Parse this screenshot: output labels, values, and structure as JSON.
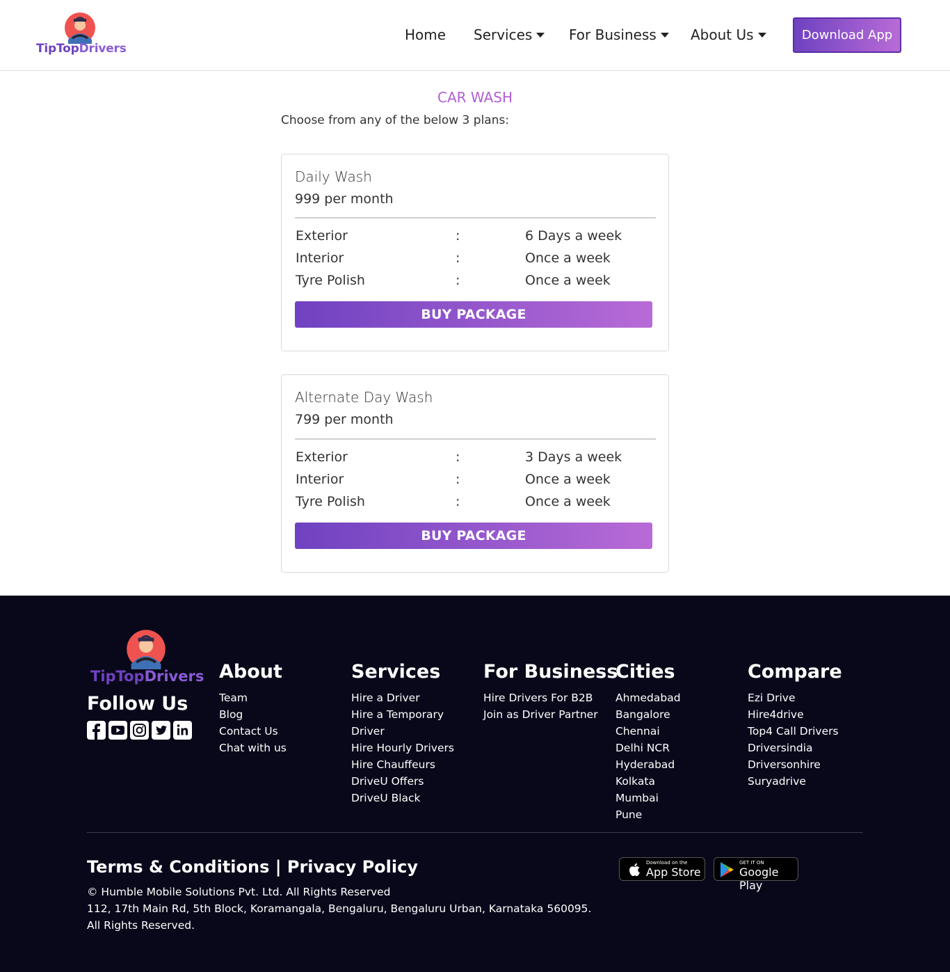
{
  "header": {
    "logo_part1": "TipTop",
    "logo_part2": "Drivers",
    "nav": {
      "home": "Home",
      "services": "Services",
      "for_business": "For Business",
      "about_us": "About Us"
    },
    "download_label": "Download App"
  },
  "main": {
    "title": "CAR WASH",
    "subtitle": "Choose from any of the below 3 plans:",
    "plans": [
      {
        "name": "Daily Wash",
        "price": "999 per month",
        "features": [
          {
            "label": "Exterior",
            "sep": ":",
            "value": "6 Days a week"
          },
          {
            "label": "Interior",
            "sep": ":",
            "value": "Once a week"
          },
          {
            "label": "Tyre Polish",
            "sep": ":",
            "value": "Once a week"
          }
        ],
        "button": "BUY PACKAGE"
      },
      {
        "name": "Alternate Day Wash",
        "price": "799 per month",
        "features": [
          {
            "label": "Exterior",
            "sep": ":",
            "value": "3 Days a week"
          },
          {
            "label": "Interior",
            "sep": ":",
            "value": "Once a week"
          },
          {
            "label": "Tyre Polish",
            "sep": ":",
            "value": "Once a week"
          }
        ],
        "button": "BUY PACKAGE"
      }
    ]
  },
  "footer": {
    "logo_part1": "TipTop",
    "logo_part2": "Drivers",
    "follow_us": "Follow Us",
    "social_icons": [
      "facebook-icon",
      "youtube-icon",
      "instagram-icon",
      "twitter-icon",
      "linkedin-icon"
    ],
    "columns": {
      "about": {
        "title": "About",
        "links": [
          "Team",
          "Blog",
          "Contact Us",
          "Chat with us"
        ]
      },
      "services": {
        "title": "Services",
        "links": [
          "Hire a Driver",
          "Hire a Temporary",
          "Driver",
          "Hire Hourly Drivers",
          "Hire Chauffeurs",
          "DriveU Offers",
          "DriveU Black"
        ]
      },
      "business": {
        "title": "For Business",
        "links": [
          "Hire Drivers For B2B",
          "Join as Driver Partner"
        ]
      },
      "cities": {
        "title": "Cities",
        "links": [
          "Ahmedabad",
          "Bangalore",
          "Chennai",
          "Delhi NCR",
          "Hyderabad",
          "Kolkata",
          "Mumbai",
          "Pune"
        ]
      },
      "compare": {
        "title": "Compare",
        "links": [
          "Ezi Drive",
          "Hire4drive",
          "Top4 Call Drivers",
          "Driversindia",
          "Driversonhire",
          "Suryadrive"
        ]
      }
    },
    "terms": "Terms & Conditions",
    "separator": "|",
    "privacy": "Privacy Policy",
    "copyright": "© Humble Mobile Solutions Pvt. Ltd. All Rights Reserved",
    "address": "112, 17th Main Rd, 5th Block, Koramangala, Bengaluru, Bengaluru Urban, Karnataka 560095.",
    "rights": "All Rights Reserved.",
    "app_store": {
      "small": "Download on the",
      "big": "App Store"
    },
    "google_play": {
      "small": "GET IT ON",
      "big": "Google Play"
    }
  },
  "colors": {
    "accent_start": "#6f42c1",
    "accent_end": "#b86bd6",
    "title_purple": "#b160d2",
    "footer_bg": "#08081a"
  }
}
